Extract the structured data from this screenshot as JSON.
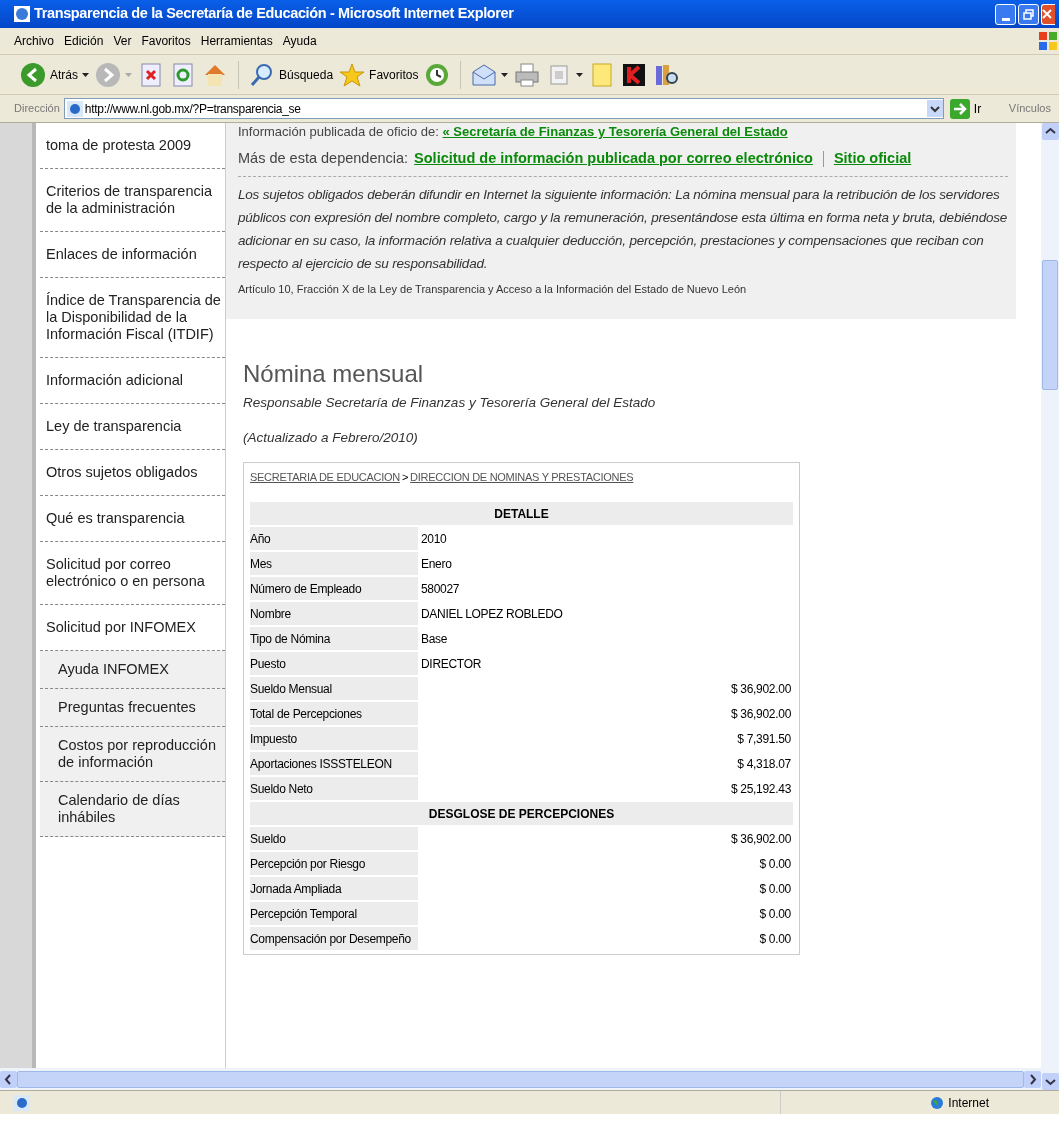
{
  "window": {
    "title": "Transparencia de la Secretaría de Educación - Microsoft Internet Explorer"
  },
  "menu": [
    "Archivo",
    "Edición",
    "Ver",
    "Favoritos",
    "Herramientas",
    "Ayuda"
  ],
  "toolbar": [
    {
      "kind": "back",
      "label": "Atrás"
    },
    {
      "kind": "forward"
    },
    {
      "kind": "stop"
    },
    {
      "kind": "refresh"
    },
    {
      "kind": "home"
    },
    {
      "kind": "search",
      "label": "Búsqueda"
    },
    {
      "kind": "favorites",
      "label": "Favoritos"
    },
    {
      "kind": "history"
    },
    {
      "kind": "mail"
    },
    {
      "kind": "print"
    },
    {
      "kind": "edit"
    },
    {
      "kind": "note"
    },
    {
      "kind": "k"
    },
    {
      "kind": "research"
    }
  ],
  "address_bar": {
    "label": "Dirección",
    "value": "http://www.nl.gob.mx/?P=transparencia_se",
    "go": "Ir",
    "links": "Vínculos"
  },
  "sidebar": {
    "items": [
      {
        "label": "toma de protesta 2009"
      },
      {
        "label": "Criterios de transparencia de la administración"
      },
      {
        "label": "Enlaces de información"
      },
      {
        "label": "Índice de Transparencia de la Disponibilidad de la Información Fiscal (ITDIF)"
      },
      {
        "label": "Información adicional"
      },
      {
        "label": "Ley de transparencia"
      },
      {
        "label": "Otros sujetos obligados"
      },
      {
        "label": "Qué es transparencia"
      },
      {
        "label": "Solicitud por correo electrónico o en persona"
      },
      {
        "label": "Solicitud por INFOMEX",
        "children": [
          {
            "label": "Ayuda INFOMEX"
          },
          {
            "label": "Preguntas frecuentes"
          },
          {
            "label": "Costos por reproducción de información"
          },
          {
            "label": "Calendario de días inhábiles"
          }
        ]
      }
    ]
  },
  "info": {
    "published_prefix": "Información publicada de oficio de:",
    "published_link": "« Secretaría de Finanzas y Tesorería General del Estado",
    "more_prefix": "Más de esta dependencia:",
    "more_links": [
      "Solicitud de información publicada por correo electrónico",
      "Sitio oficial"
    ],
    "description": "Los sujetos obligados deberán difundir en Internet la siguiente información: La nómina mensual para la retribución de los servidores públicos con expresión del nombre completo, cargo y la remuneración, presentándose esta última en forma neta y bruta, debiéndose adicionar en su caso, la información relativa a cualquier deducción, percepción, prestaciones y compensaciones que reciban con respecto al ejercicio de su responsabilidad.",
    "legal_reference": "Artículo 10, Fracción X de la Ley de Transparencia y Acceso a la Información del Estado de Nuevo León"
  },
  "heading": "Nómina mensual",
  "responsible": "Responsable Secretaría de Finanzas y Tesorería General del Estado",
  "updated": "(Actualizado a Febrero/2010)",
  "breadcrumb": [
    {
      "label": "SECRETARIA DE EDUCACION"
    },
    {
      "label": "DIRECCION DE NOMINAS Y PRESTACIONES"
    }
  ],
  "breadcrumb_separator": ">",
  "table": {
    "rows": [
      {
        "kind": "header",
        "label": "DETALLE"
      },
      {
        "kind": "text",
        "label": "Año",
        "value": "2010"
      },
      {
        "kind": "text",
        "label": "Mes",
        "value": "Enero"
      },
      {
        "kind": "text",
        "label": "Número de Empleado",
        "value": "580027"
      },
      {
        "kind": "text",
        "label": "Nombre",
        "value": "DANIEL LOPEZ ROBLEDO"
      },
      {
        "kind": "text",
        "label": "Tipo de Nómina",
        "value": "Base"
      },
      {
        "kind": "text",
        "label": "Puesto",
        "value": "DIRECTOR"
      },
      {
        "kind": "amount",
        "label": "Sueldo Mensual",
        "value": "$ 36,902.00"
      },
      {
        "kind": "amount",
        "label": "Total de Percepciones",
        "value": "$ 36,902.00"
      },
      {
        "kind": "amount",
        "label": "Impuesto",
        "value": "$ 7,391.50"
      },
      {
        "kind": "amount",
        "label": "Aportaciones ISSSTELEON",
        "value": "$ 4,318.07"
      },
      {
        "kind": "amount",
        "label": "Sueldo Neto",
        "value": "$ 25,192.43"
      },
      {
        "kind": "header",
        "label": "DESGLOSE DE PERCEPCIONES"
      },
      {
        "kind": "amount",
        "label": "Sueldo",
        "value": "$ 36,902.00"
      },
      {
        "kind": "amount",
        "label": "Percepción por Riesgo",
        "value": "$ 0.00"
      },
      {
        "kind": "amount",
        "label": "Jornada Ampliada",
        "value": "$ 0.00"
      },
      {
        "kind": "amount",
        "label": "Percepción Temporal",
        "value": "$ 0.00"
      },
      {
        "kind": "amount",
        "label": "Compensación por Desempeño",
        "value": "$ 0.00"
      }
    ]
  },
  "status_bar": {
    "zone": "Internet"
  }
}
